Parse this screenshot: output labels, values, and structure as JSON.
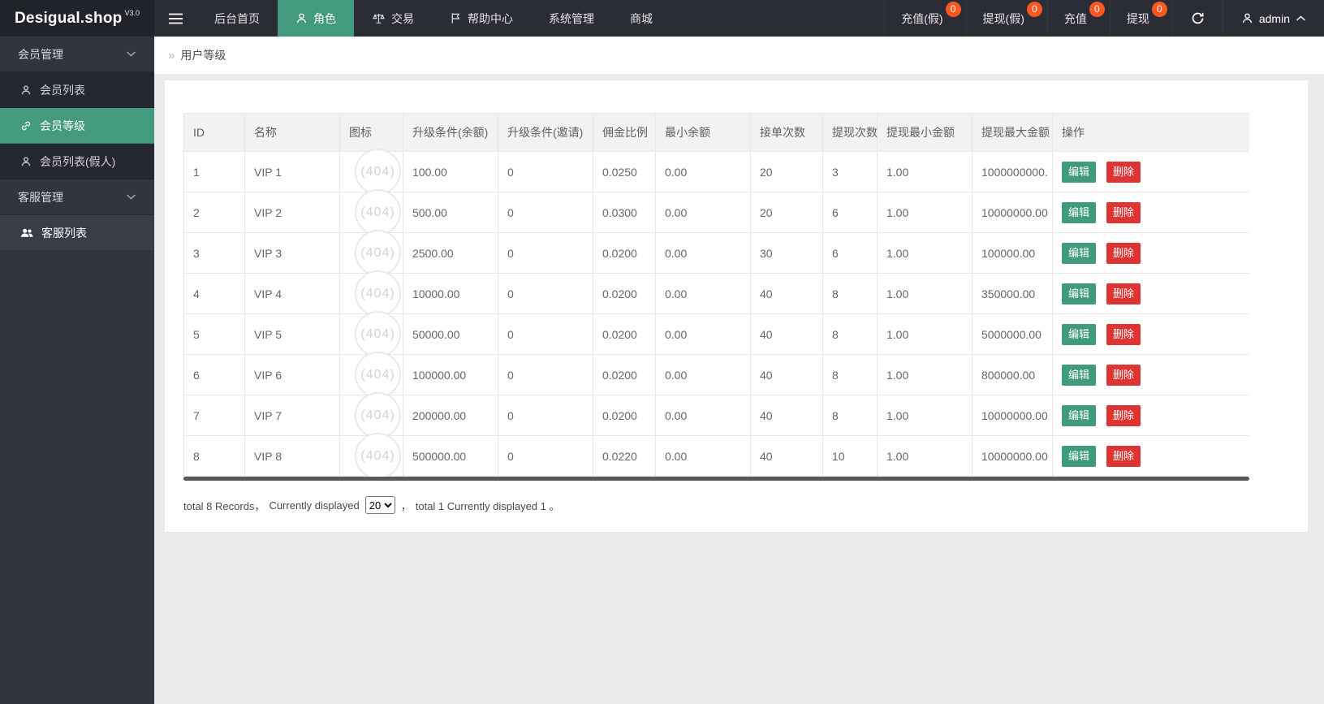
{
  "brand": {
    "name": "Desigual.shop",
    "version": "V3.0"
  },
  "topnav": {
    "menu": [
      {
        "label": "后台首页",
        "icon": null
      },
      {
        "label": "角色",
        "icon": "person-icon",
        "active": true
      },
      {
        "label": "交易",
        "icon": "scales-icon"
      },
      {
        "label": "帮助中心",
        "icon": "flag-icon"
      },
      {
        "label": "系统管理",
        "icon": null
      },
      {
        "label": "商城",
        "icon": null
      }
    ],
    "quick": [
      {
        "label": "充值(假)",
        "badge": "0"
      },
      {
        "label": "提现(假)",
        "badge": "0"
      },
      {
        "label": "充值",
        "badge": "0"
      },
      {
        "label": "提现",
        "badge": "0"
      }
    ],
    "user": {
      "name": "admin"
    }
  },
  "sidebar": {
    "items": [
      {
        "label": "会员管理",
        "type": "section"
      },
      {
        "label": "会员列表",
        "type": "child",
        "icon": "person-icon"
      },
      {
        "label": "会员等级",
        "type": "child",
        "icon": "link-icon",
        "active": true
      },
      {
        "label": "会员列表(假人)",
        "type": "child",
        "icon": "person-icon"
      },
      {
        "label": "客服管理",
        "type": "section"
      },
      {
        "label": "客服列表",
        "type": "child",
        "icon": "users-icon"
      }
    ]
  },
  "breadcrumb": {
    "arrow": "»",
    "title": "用户等级"
  },
  "table": {
    "columns": [
      "ID",
      "名称",
      "图标",
      "升级条件(余额)",
      "升级条件(邀请)",
      "佣金比例",
      "最小余额",
      "接单次数",
      "提现次数",
      "提现最小金额",
      "提现最大金额",
      "操作"
    ],
    "icon_text": "(404)",
    "actions": {
      "edit": "编辑",
      "delete": "删除"
    },
    "rows": [
      {
        "id": "1",
        "name": "VIP 1",
        "upgrade_balance": "100.00",
        "upgrade_invite": "0",
        "commission": "0.0250",
        "min_balance": "0.00",
        "order_count": "20",
        "withdraw_count": "3",
        "withdraw_min": "1.00",
        "withdraw_max": "1000000000."
      },
      {
        "id": "2",
        "name": "VIP 2",
        "upgrade_balance": "500.00",
        "upgrade_invite": "0",
        "commission": "0.0300",
        "min_balance": "0.00",
        "order_count": "20",
        "withdraw_count": "6",
        "withdraw_min": "1.00",
        "withdraw_max": "10000000.00"
      },
      {
        "id": "3",
        "name": "VIP 3",
        "upgrade_balance": "2500.00",
        "upgrade_invite": "0",
        "commission": "0.0200",
        "min_balance": "0.00",
        "order_count": "30",
        "withdraw_count": "6",
        "withdraw_min": "1.00",
        "withdraw_max": "100000.00"
      },
      {
        "id": "4",
        "name": "VIP 4",
        "upgrade_balance": "10000.00",
        "upgrade_invite": "0",
        "commission": "0.0200",
        "min_balance": "0.00",
        "order_count": "40",
        "withdraw_count": "8",
        "withdraw_min": "1.00",
        "withdraw_max": "350000.00"
      },
      {
        "id": "5",
        "name": "VIP 5",
        "upgrade_balance": "50000.00",
        "upgrade_invite": "0",
        "commission": "0.0200",
        "min_balance": "0.00",
        "order_count": "40",
        "withdraw_count": "8",
        "withdraw_min": "1.00",
        "withdraw_max": "5000000.00"
      },
      {
        "id": "6",
        "name": "VIP 6",
        "upgrade_balance": "100000.00",
        "upgrade_invite": "0",
        "commission": "0.0200",
        "min_balance": "0.00",
        "order_count": "40",
        "withdraw_count": "8",
        "withdraw_min": "1.00",
        "withdraw_max": "800000.00"
      },
      {
        "id": "7",
        "name": "VIP 7",
        "upgrade_balance": "200000.00",
        "upgrade_invite": "0",
        "commission": "0.0200",
        "min_balance": "0.00",
        "order_count": "40",
        "withdraw_count": "8",
        "withdraw_min": "1.00",
        "withdraw_max": "10000000.00"
      },
      {
        "id": "8",
        "name": "VIP 8",
        "upgrade_balance": "500000.00",
        "upgrade_invite": "0",
        "commission": "0.0220",
        "min_balance": "0.00",
        "order_count": "40",
        "withdraw_count": "10",
        "withdraw_min": "1.00",
        "withdraw_max": "10000000.00"
      }
    ]
  },
  "pagination": {
    "prefix": "total 8 Records，",
    "label": "Currently displayed",
    "page_size": "20",
    "comma": "，",
    "suffix": "total 1 Currently displayed 1 。"
  },
  "colors": {
    "accent_green": "#449a7e",
    "button_green": "#3f9b7b",
    "danger_red": "#df3434",
    "badge_orange": "#ff5722"
  }
}
